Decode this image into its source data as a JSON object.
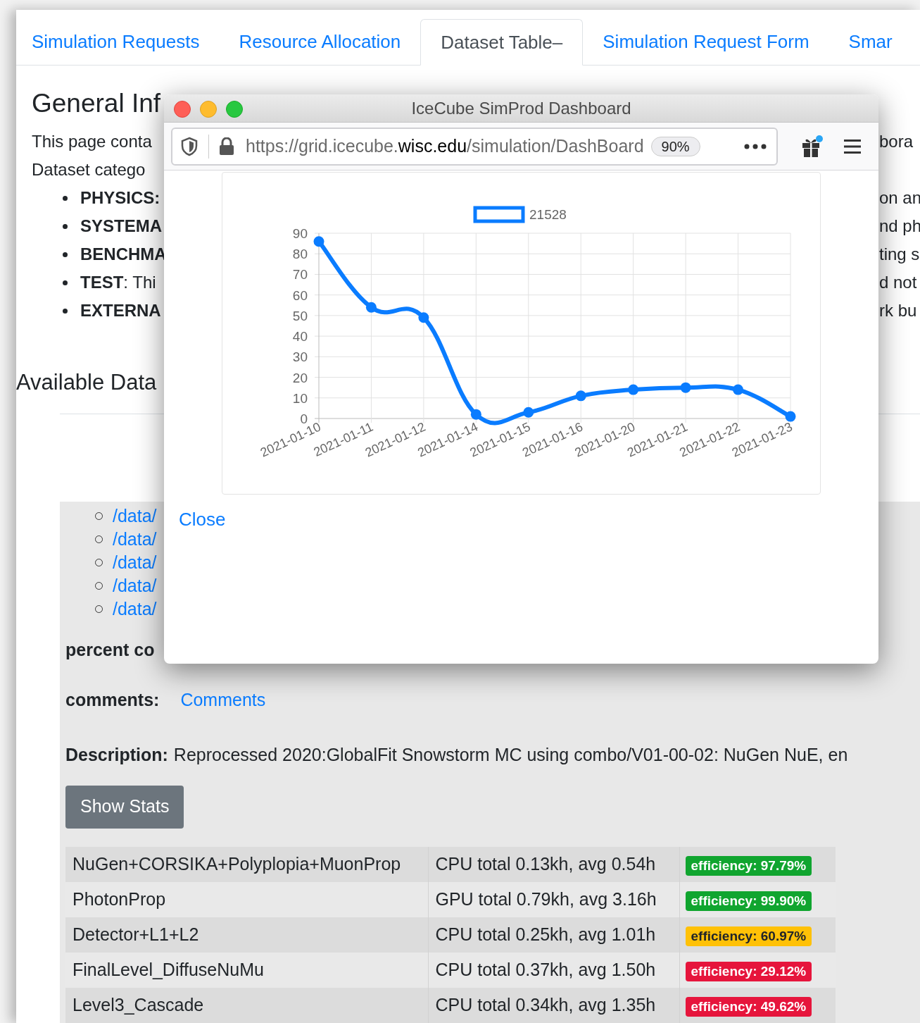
{
  "tabs": [
    {
      "label": "Simulation Requests",
      "selected": false
    },
    {
      "label": "Resource Allocation",
      "selected": false
    },
    {
      "label": "Dataset Table–",
      "selected": true
    },
    {
      "label": "Simulation Request Form",
      "selected": false
    },
    {
      "label": "Smar",
      "selected": false
    }
  ],
  "general_info": {
    "heading": "General Inf",
    "intro_lines": [
      {
        "left": "This page conta",
        "right": "bora"
      },
      {
        "left": "Dataset catego"
      }
    ],
    "categories": [
      {
        "text": "**PHYSICS:**",
        "right": "on an"
      },
      {
        "text": "**SYSTEMA**",
        "right": "nd ph"
      },
      {
        "text": "**BENCHMA**",
        "right": "ting s"
      },
      {
        "text": "**TEST**: Thi",
        "right": "d not"
      },
      {
        "text": "**EXTERNA**",
        "right": "rk bu"
      }
    ]
  },
  "available_heading": "Available Data",
  "data_links": [
    "/data/",
    "/data/",
    "/data/",
    "/data/",
    "/data/"
  ],
  "percent_label": "percent co",
  "comments": {
    "label": "comments:",
    "link": "Comments"
  },
  "description": {
    "label": "Description:",
    "text": "Reprocessed 2020:GlobalFit Snowstorm MC using combo/V01-00-02: NuGen NuE, en"
  },
  "show_stats_button": "Show Stats",
  "stats_table": {
    "rows": [
      {
        "step": "NuGen+CORSIKA+Polyplopia+MuonProp",
        "usage": "CPU total 0.13kh, avg 0.54h",
        "efficiency": "efficiency: 97.79%",
        "color": "#10a52f"
      },
      {
        "step": "PhotonProp",
        "usage": "GPU total 0.79kh, avg 3.16h",
        "efficiency": "efficiency: 99.90%",
        "color": "#10a52f"
      },
      {
        "step": "Detector+L1+L2",
        "usage": "CPU total 0.25kh, avg 1.01h",
        "efficiency": "efficiency: 60.97%",
        "color": "#ffc107"
      },
      {
        "step": "FinalLevel_DiffuseNuMu",
        "usage": "CPU total 0.37kh, avg 1.50h",
        "efficiency": "efficiency: 29.12%",
        "color": "#e6153c"
      },
      {
        "step": "Level3_Cascade",
        "usage": "CPU total 0.34kh, avg 1.35h",
        "efficiency": "efficiency: 49.62%",
        "color": "#e6153c"
      }
    ]
  },
  "popup_window": {
    "title": "IceCube SimProd Dashboard",
    "url": "https://grid.icecube.**wisc.edu**/simulation/DashBoard",
    "zoom": "90%",
    "chart": {
      "chart_data": {
        "type": "line",
        "categories": [
          "2021-01-10",
          "2021-01-11",
          "2021-01-12",
          "2021-01-14",
          "2021-01-15",
          "2021-01-16",
          "2021-01-20",
          "2021-01-21",
          "2021-01-22",
          "2021-01-23"
        ],
        "series": [
          {
            "name": "21528",
            "color": "#0a7cff",
            "marker": true,
            "values": [
              86,
              54,
              49,
              2,
              3,
              11,
              14,
              15,
              14,
              1
            ]
          }
        ],
        "grid": true,
        "ylim": [
          0,
          90
        ],
        "yticks": [
          0,
          10,
          20,
          30,
          40,
          50,
          60,
          70,
          80,
          90
        ]
      }
    },
    "close_link": "Close"
  }
}
